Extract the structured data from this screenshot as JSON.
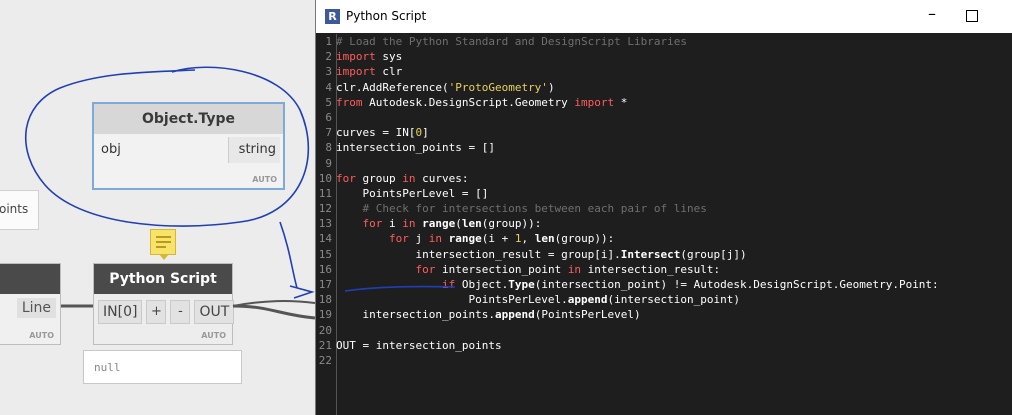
{
  "window": {
    "title": "Python Script",
    "app_icon": "R"
  },
  "nodes": {
    "object_type": {
      "title": "Object.Type",
      "input": "obj",
      "output": "string",
      "lacing": "AUTO"
    },
    "points_partial": {
      "label": "oints"
    },
    "line_partial": {
      "output": "Line",
      "lacing": "AUTO"
    },
    "python_script": {
      "title": "Python Script",
      "input": "IN[0]",
      "add": "+",
      "remove": "-",
      "output": "OUT",
      "lacing": "AUTO"
    },
    "preview": {
      "value": "null"
    }
  },
  "code_lines": [
    {
      "n": "1",
      "parts": [
        {
          "t": "# Load the Python Standard and DesignScript Libraries",
          "c": "com"
        }
      ]
    },
    {
      "n": "2",
      "parts": [
        {
          "t": "import",
          "c": "kw"
        },
        {
          "t": " sys",
          "c": ""
        }
      ]
    },
    {
      "n": "3",
      "parts": [
        {
          "t": "import",
          "c": "kw"
        },
        {
          "t": " clr",
          "c": ""
        }
      ]
    },
    {
      "n": "4",
      "parts": [
        {
          "t": "clr.AddReference(",
          "c": ""
        },
        {
          "t": "'ProtoGeometry'",
          "c": "str"
        },
        {
          "t": ")",
          "c": ""
        }
      ]
    },
    {
      "n": "5",
      "parts": [
        {
          "t": "from",
          "c": "kw"
        },
        {
          "t": " Autodesk.DesignScript.Geometry ",
          "c": ""
        },
        {
          "t": "import",
          "c": "kw"
        },
        {
          "t": " *",
          "c": ""
        }
      ]
    },
    {
      "n": "6",
      "parts": []
    },
    {
      "n": "7",
      "parts": [
        {
          "t": "curves = IN[",
          "c": ""
        },
        {
          "t": "0",
          "c": "str"
        },
        {
          "t": "]",
          "c": ""
        }
      ]
    },
    {
      "n": "8",
      "parts": [
        {
          "t": "intersection_points = []",
          "c": ""
        }
      ]
    },
    {
      "n": "9",
      "parts": []
    },
    {
      "n": "10",
      "parts": [
        {
          "t": "for",
          "c": "kw"
        },
        {
          "t": " group ",
          "c": ""
        },
        {
          "t": "in",
          "c": "kw"
        },
        {
          "t": " curves:",
          "c": ""
        }
      ]
    },
    {
      "n": "11",
      "parts": [
        {
          "t": "    PointsPerLevel = []",
          "c": ""
        }
      ]
    },
    {
      "n": "12",
      "parts": [
        {
          "t": "    # Check for intersections between each pair of lines",
          "c": "com"
        }
      ]
    },
    {
      "n": "13",
      "parts": [
        {
          "t": "    ",
          "c": ""
        },
        {
          "t": "for",
          "c": "kw"
        },
        {
          "t": " i ",
          "c": ""
        },
        {
          "t": "in",
          "c": "kw"
        },
        {
          "t": " ",
          "c": ""
        },
        {
          "t": "range",
          "c": "fn"
        },
        {
          "t": "(",
          "c": ""
        },
        {
          "t": "len",
          "c": "fn"
        },
        {
          "t": "(group)):",
          "c": ""
        }
      ]
    },
    {
      "n": "14",
      "parts": [
        {
          "t": "        ",
          "c": ""
        },
        {
          "t": "for",
          "c": "kw"
        },
        {
          "t": " j ",
          "c": ""
        },
        {
          "t": "in",
          "c": "kw"
        },
        {
          "t": " ",
          "c": ""
        },
        {
          "t": "range",
          "c": "fn"
        },
        {
          "t": "(i + ",
          "c": ""
        },
        {
          "t": "1",
          "c": "str"
        },
        {
          "t": ", ",
          "c": ""
        },
        {
          "t": "len",
          "c": "fn"
        },
        {
          "t": "(group)):",
          "c": ""
        }
      ]
    },
    {
      "n": "15",
      "parts": [
        {
          "t": "            intersection_result = group[i].",
          "c": ""
        },
        {
          "t": "Intersect",
          "c": "fn"
        },
        {
          "t": "(group[j])",
          "c": ""
        }
      ]
    },
    {
      "n": "16",
      "parts": [
        {
          "t": "            ",
          "c": ""
        },
        {
          "t": "for",
          "c": "kw"
        },
        {
          "t": " intersection_point ",
          "c": ""
        },
        {
          "t": "in",
          "c": "kw"
        },
        {
          "t": " intersection_result:",
          "c": ""
        }
      ]
    },
    {
      "n": "17",
      "parts": [
        {
          "t": "                ",
          "c": ""
        },
        {
          "t": "if",
          "c": "kw"
        },
        {
          "t": " Object.",
          "c": ""
        },
        {
          "t": "Type",
          "c": "fn"
        },
        {
          "t": "(intersection_point) != Autodesk.DesignScript.Geometry.Point:",
          "c": ""
        }
      ]
    },
    {
      "n": "18",
      "parts": [
        {
          "t": "                    PointsPerLevel.",
          "c": ""
        },
        {
          "t": "append",
          "c": "fn"
        },
        {
          "t": "(intersection_point)",
          "c": ""
        }
      ]
    },
    {
      "n": "19",
      "parts": [
        {
          "t": "    intersection_points.",
          "c": ""
        },
        {
          "t": "append",
          "c": "fn"
        },
        {
          "t": "(PointsPerLevel)",
          "c": ""
        }
      ]
    },
    {
      "n": "20",
      "parts": []
    },
    {
      "n": "21",
      "parts": [
        {
          "t": "OUT = intersection_points",
          "c": ""
        }
      ]
    },
    {
      "n": "22",
      "parts": []
    }
  ],
  "colors": {
    "keyword": "#ff5c5c",
    "string": "#e8d15e",
    "comment": "#6f6f6f",
    "annotation_ink": "#1f3fb5"
  }
}
